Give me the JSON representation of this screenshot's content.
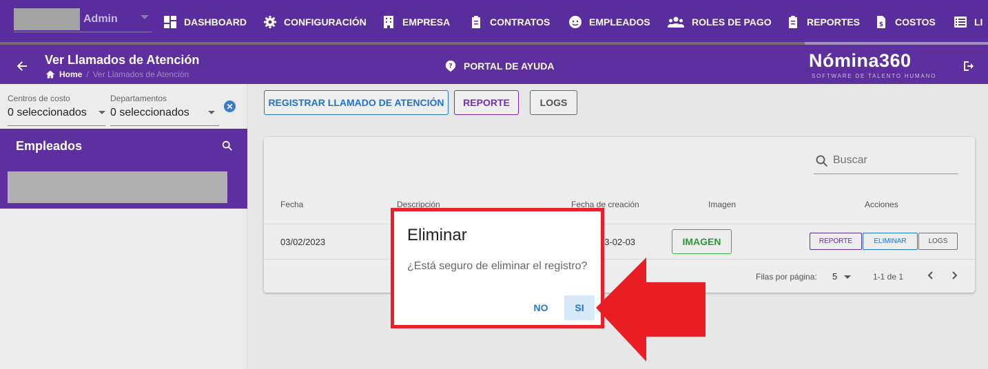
{
  "topnav": {
    "user_label": "Admin",
    "items": [
      {
        "label": "DASHBOARD",
        "icon": "dashboard-icon"
      },
      {
        "label": "CONFIGURACIÓN",
        "icon": "gear-icon"
      },
      {
        "label": "EMPRESA",
        "icon": "building-icon"
      },
      {
        "label": "CONTRATOS",
        "icon": "clipboard-icon"
      },
      {
        "label": "EMPLEADOS",
        "icon": "face-icon"
      },
      {
        "label": "ROLES DE PAGO",
        "icon": "group-icon"
      },
      {
        "label": "REPORTES",
        "icon": "clipboard-icon"
      },
      {
        "label": "COSTOS",
        "icon": "file-dollar-icon"
      },
      {
        "label": "LI",
        "icon": "list-icon"
      }
    ]
  },
  "header": {
    "title": "Ver Llamados de Atención",
    "breadcrumb": {
      "home": "Home",
      "separator": "/",
      "current": "Ver Llamados de Atención"
    },
    "help_label": "PORTAL DE AYUDA",
    "brand": "Nómina360",
    "brand_sub": "SOFTWARE DE TALENTO HUMANO"
  },
  "filters": {
    "cost_centers": {
      "label": "Centros de costo",
      "value": "0 seleccionados"
    },
    "departments": {
      "label": "Departamentos",
      "value": "0 seleccionados"
    }
  },
  "employees": {
    "title": "Empleados"
  },
  "toolbar": {
    "register_label": "REGISTRAR LLAMADO DE ATENCIÓN",
    "report_label": "REPORTE",
    "logs_label": "LOGS"
  },
  "table": {
    "search_placeholder": "Buscar",
    "headers": {
      "fecha": "Fecha",
      "descripcion": "Descripción",
      "fecha_creacion": "Fecha de creación",
      "imagen": "Imagen",
      "acciones": "Acciones"
    },
    "rows": [
      {
        "fecha": "03/02/2023",
        "fecha_creacion_visible": "23-02-03",
        "imagen_label": "IMAGEN",
        "reporte_label": "REPORTE",
        "eliminar_label": "ELIMINAR",
        "logs_label": "LOGS"
      }
    ],
    "footer": {
      "rows_per_page_label": "Filas por página:",
      "rows_per_page": "5",
      "range": "1-1 de 1"
    }
  },
  "dialog": {
    "title": "Eliminar",
    "message": "¿Está seguro de eliminar el registro?",
    "no_label": "NO",
    "yes_label": "SI"
  },
  "colors": {
    "primary": "#5e2f9f",
    "highlight": "#e8202b",
    "action_blue": "#1b77d2",
    "success": "#2e9a3d"
  }
}
